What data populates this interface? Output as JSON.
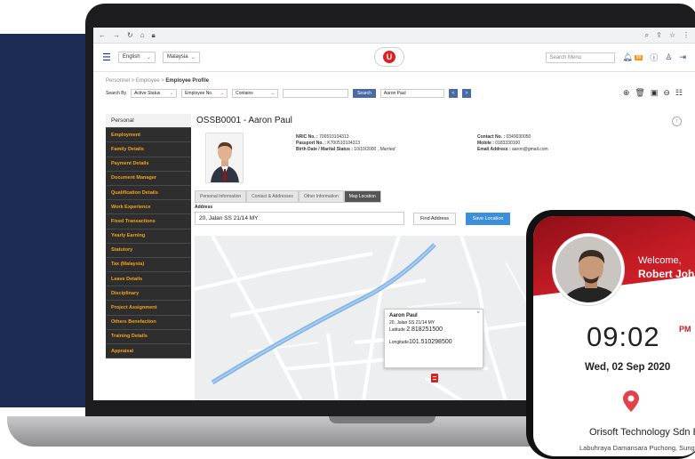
{
  "header": {
    "language": "English",
    "country": "Malaysia",
    "logo_letter": "U",
    "search_placeholder": "Search Menu",
    "notif_count": "99"
  },
  "breadcrumb": {
    "part1": "Personnel",
    "part2": "Employee",
    "current": "Employee Profile"
  },
  "search": {
    "label": "Search By",
    "status": "Active Status",
    "field": "Employee No.",
    "operator": "Contains",
    "button": "Search",
    "result": "Aaron Paul",
    "prev": "<",
    "next": ">"
  },
  "sidebar": {
    "items": [
      {
        "label": "Personal"
      },
      {
        "label": "Employment"
      },
      {
        "label": "Family Details"
      },
      {
        "label": "Payment Details"
      },
      {
        "label": "Document Manager"
      },
      {
        "label": "Qualification Details"
      },
      {
        "label": "Work Experience"
      },
      {
        "label": "Fixed Transactions"
      },
      {
        "label": "Yearly Earning"
      },
      {
        "label": "Statutory"
      },
      {
        "label": "Tax (Malaysia)"
      },
      {
        "label": "Leave Details"
      },
      {
        "label": "Disciplinary"
      },
      {
        "label": "Project Assignment"
      },
      {
        "label": "Others Benefaction"
      },
      {
        "label": "Training Details"
      },
      {
        "label": "Appraisal"
      }
    ]
  },
  "employee": {
    "title": "OSSB0001 -  Aaron Paul",
    "nric_label": "NRIC No. :",
    "nric": "700510104313",
    "passport_label": "Passport No. :",
    "passport": "K700510104313",
    "birth_label": "Birth Date / Marital Status :",
    "birth": "10/10/2000 ,",
    "marital": "Married",
    "contact_label": "Contact No. :",
    "contact": "0349030050",
    "mobile_label": "Mobile :",
    "mobile": "0183330100",
    "email_label": "Email Address :",
    "email": "aaron@gmail.com"
  },
  "tabs": [
    {
      "label": "Personal Information"
    },
    {
      "label": "Contact & Addresses"
    },
    {
      "label": "Other Information"
    },
    {
      "label": "Map Location"
    }
  ],
  "address": {
    "label": "Address",
    "value": "20, Jalan SS 21/14 MY",
    "find_button": "Find Address",
    "save_button": "Save Location"
  },
  "map_popup": {
    "name": "Aaron Paul",
    "address": "20, Jalan SS 21/14 MY",
    "latitude_label": "Latitude",
    "latitude": "2.818251500",
    "longitude_label": "Longitude",
    "longitude": "101.510298500"
  },
  "phone": {
    "welcome": "Welcome,",
    "name": "Robert John",
    "time": "09:02",
    "ampm": "PM",
    "date": "Wed, 02 Sep 2020",
    "company": "Orisoft Technology Sdn Bhd",
    "address": "Labuhraya Damansara Puchong, Sungai Buloh"
  },
  "colors": {
    "sidebar_bg": "#2e2e2e",
    "sidebar_text": "#f7a21b",
    "primary_button": "#3d8fd8",
    "brand_red": "#c31b24",
    "navy_bg": "#1c2c55"
  }
}
